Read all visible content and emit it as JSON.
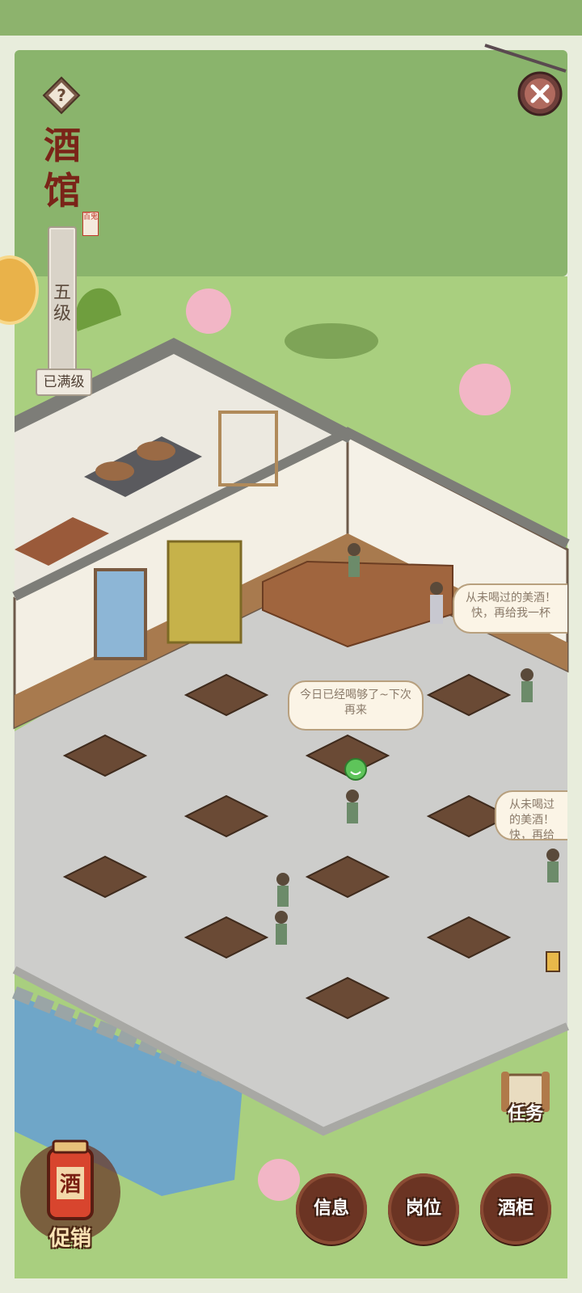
{
  "header": {
    "title_chars": [
      "酒",
      "馆"
    ],
    "seal": "百鬼",
    "level": "五级",
    "level_status": "已满级"
  },
  "icons": {
    "help": "question-icon",
    "close": "close-icon",
    "task": "scroll-icon",
    "promo": "wine-jar-icon"
  },
  "bubbles": {
    "center": "今日已经喝够了~下次再来",
    "right_top": "从未喝过的美酒！快，再给我一杯",
    "right_mid": "从未喝过的美酒！快，再给我"
  },
  "actions": {
    "task": "任务",
    "info": "信息",
    "post": "岗位",
    "cabinet": "酒柜",
    "promo": "促销",
    "promo_jar_char": "酒"
  },
  "colors": {
    "grass": "#a9cf7f",
    "floor": "#cfcfcf",
    "wood_dark": "#6b3423",
    "title_red": "#7a2418"
  }
}
